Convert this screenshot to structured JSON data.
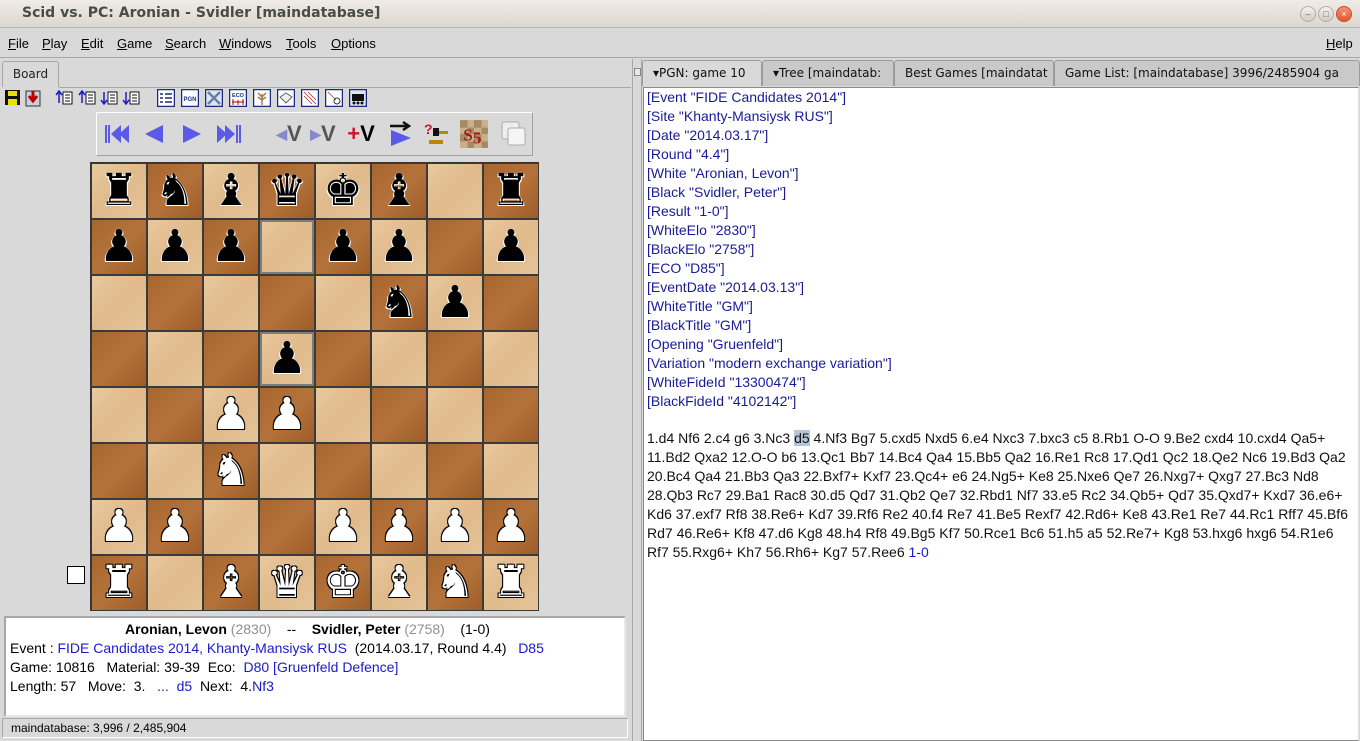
{
  "window": {
    "title": "Scid vs. PC: Aronian - Svidler [maindatabase]",
    "controls": [
      "minimize",
      "maximize",
      "close"
    ]
  },
  "menubar": {
    "items": [
      {
        "label": "File",
        "mnemonic": "F",
        "rest": "ile"
      },
      {
        "label": "Play",
        "mnemonic": "P",
        "rest": "lay"
      },
      {
        "label": "Edit",
        "mnemonic": "E",
        "rest": "dit"
      },
      {
        "label": "Game",
        "mnemonic": "G",
        "rest": "ame"
      },
      {
        "label": "Search",
        "mnemonic": "S",
        "rest": "earch"
      },
      {
        "label": "Windows",
        "mnemonic": "W",
        "rest": "indows"
      },
      {
        "label": "Tools",
        "mnemonic": "T",
        "rest": "ools"
      },
      {
        "label": "Options",
        "mnemonic": "O",
        "rest": "ptions"
      }
    ],
    "help": {
      "label": "Help",
      "mnemonic": "H",
      "rest": "elp"
    }
  },
  "board_panel": {
    "tab_label": "Board",
    "toolbar": [
      "save-icon",
      "save-as-icon",
      "first-game-icon",
      "prev-game-icon",
      "next-game-icon",
      "last-game-icon",
      "gamelist-icon",
      "pgn-icon",
      "tools-icon",
      "eco-icon",
      "tree-icon",
      "open-icon",
      "crosstable-icon",
      "search-icon",
      "engine-icon"
    ],
    "nav": {
      "pgn_label": "PGN",
      "eco_label": "ECO",
      "var_label": "V",
      "add_var_label": "+V"
    },
    "board": {
      "ranks": [
        [
          "r",
          "n",
          "b",
          "q",
          "k",
          "b",
          "",
          "r"
        ],
        [
          "p",
          "p",
          "p",
          "",
          "p",
          "p",
          "",
          "p"
        ],
        [
          "",
          "",
          "",
          "",
          "",
          "n",
          "p",
          ""
        ],
        [
          "",
          "",
          "",
          "p",
          "",
          "",
          "",
          ""
        ],
        [
          "",
          "",
          "P",
          "P",
          "",
          "",
          "",
          ""
        ],
        [
          "",
          "",
          "N",
          "",
          "",
          "",
          "",
          ""
        ],
        [
          "P",
          "P",
          "",
          "",
          "P",
          "P",
          "P",
          "P"
        ],
        [
          "R",
          "",
          "B",
          "Q",
          "K",
          "B",
          "N",
          "R"
        ]
      ],
      "highlight_squares": [
        "d7",
        "d5"
      ],
      "side_to_move": "white"
    },
    "info": {
      "white": "Aronian, Levon",
      "white_elo": "(2830)",
      "separator": "--",
      "black": "Svidler, Peter",
      "black_elo": "(2758)",
      "result": "(1-0)",
      "event_label": "Event :",
      "event": "FIDE Candidates 2014, Khanty-Mansiysk RUS",
      "event_detail": "(2014.03.17, Round 4.4)",
      "eco_code": "D85",
      "game_label": "Game:",
      "game_num": "10816",
      "material_label": "Material:",
      "material": "39-39",
      "eco_label": "Eco:",
      "eco_name": "D80 [Gruenfeld Defence]",
      "length_label": "Length:",
      "length": "57",
      "move_label": "Move:",
      "move_num": "3.",
      "move_dots": "...",
      "move": "d5",
      "next_label": "Next:",
      "next_num": "4.",
      "next_move": "Nf3"
    },
    "status": "maindatabase:  3,996 / 2,485,904"
  },
  "right_panel": {
    "tabs": [
      {
        "label": "▾PGN: game 10",
        "active": true
      },
      {
        "label": "▾Tree [maindatab:",
        "active": false
      },
      {
        "label": "Best Games [maindatat",
        "active": false
      },
      {
        "label": "Game List: [maindatabase] 3996/2485904 ga",
        "active": false
      }
    ],
    "pgn": {
      "tags": [
        "[Event \"FIDE Candidates 2014\"]",
        "[Site \"Khanty-Mansiysk RUS\"]",
        "[Date \"2014.03.17\"]",
        "[Round \"4.4\"]",
        "[White \"Aronian, Levon\"]",
        "[Black \"Svidler, Peter\"]",
        "[Result \"1-0\"]",
        "[WhiteElo \"2830\"]",
        "[BlackElo \"2758\"]",
        "[ECO \"D85\"]",
        "[EventDate \"2014.03.13\"]",
        "[WhiteTitle \"GM\"]",
        "[BlackTitle \"GM\"]",
        "[Opening \"Gruenfeld\"]",
        "[Variation \"modern exchange variation\"]",
        "[WhiteFideId \"13300474\"]",
        "[BlackFideId \"4102142\"]"
      ],
      "moves_before": "1.d4 Nf6 2.c4 g6 3.Nc3 ",
      "current_move": "d5",
      "moves_after": " 4.Nf3 Bg7 5.cxd5 Nxd5 6.e4 Nxc3 7.bxc3 c5 8.Rb1 O-O 9.Be2 cxd4 10.cxd4 Qa5+ 11.Bd2 Qxa2 12.O-O b6 13.Qc1 Bb7 14.Bc4 Qa4 15.Bb5 Qa2 16.Re1 Rc8 17.Qd1 Qc2 18.Qe2 Nc6 19.Bd3 Qa2 20.Bc4 Qa4 21.Bb3 Qa3 22.Bxf7+ Kxf7 23.Qc4+ e6 24.Ng5+ Ke8 25.Nxe6 Qe7 26.Nxg7+ Qxg7 27.Bc3 Nd8 28.Qb3 Rc7 29.Ba1 Rac8 30.d5 Qd7 31.Qb2 Qe7 32.Rbd1 Nf7 33.e5 Rc2 34.Qb5+ Qd7 35.Qxd7+ Kxd7 36.e6+ Kd6 37.exf7 Rf8 38.Re6+ Kd7 39.Rf6 Re2 40.f4 Re7 41.Be5 Rexf7 42.Rd6+ Ke8 43.Re1 Re7 44.Rc1 Rff7 45.Bf6 Rd7 46.Re6+ Kf8 47.d6 Kg8 48.h4 Rf8 49.Bg5 Kf7 50.Rce1 Bc6 51.h5 a5 52.Re7+ Kg8 53.hxg6 hxg6 54.R1e6 Rf7 55.Rxg6+ Kh7 56.Rh6+ Kg7 57.Ree6 ",
      "result": "1-0"
    }
  },
  "colors": {
    "link_blue": "#1a1acc",
    "tag_blue": "#1a1a99",
    "light_square": "#e3c195",
    "dark_square": "#a8662f",
    "current_move_bg": "#b5c5db"
  }
}
